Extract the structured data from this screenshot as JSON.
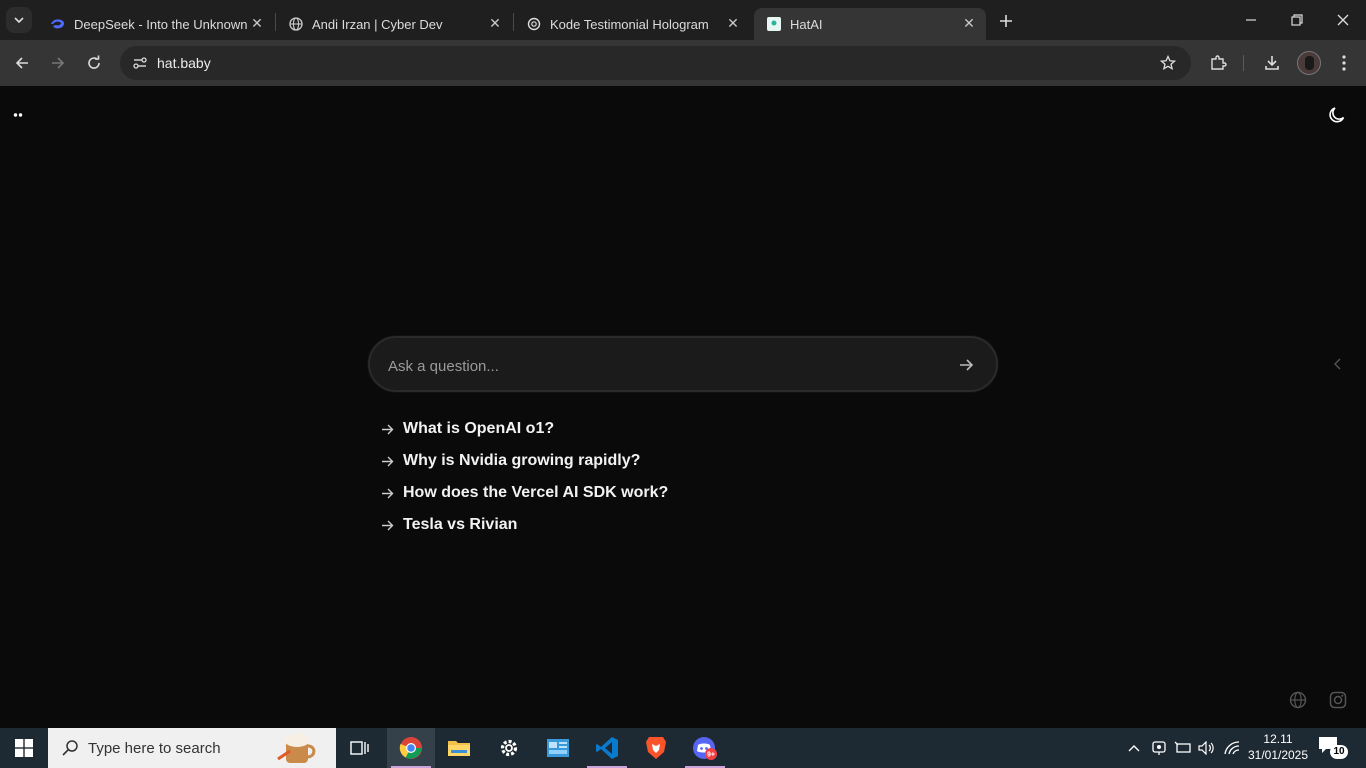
{
  "browser": {
    "tabs": [
      {
        "title": "DeepSeek - Into the Unknown",
        "icon": "deepseek-whale-icon",
        "active": false
      },
      {
        "title": "Andi Irzan | Cyber Dev",
        "icon": "globe-icon",
        "active": false
      },
      {
        "title": "Kode Testimonial Hologram",
        "icon": "chatgpt-icon",
        "active": false
      },
      {
        "title": "HatAI",
        "icon": "hatai-favicon",
        "active": true
      }
    ],
    "url": "hat.baby"
  },
  "page": {
    "search": {
      "placeholder": "Ask a question...",
      "value": ""
    },
    "suggestions": [
      "What is OpenAI o1?",
      "Why is Nvidia growing rapidly?",
      "How does the Vercel AI SDK work?",
      "Tesla vs Rivian"
    ]
  },
  "taskbar": {
    "search_placeholder": "Type here to search",
    "apps": [
      "task-view",
      "chrome",
      "file-explorer",
      "settings",
      "control-panel",
      "vscode",
      "brave",
      "discord"
    ],
    "discord_badge": "9+",
    "time": "12.11",
    "date": "31/01/2025",
    "notifications": "10"
  },
  "colors": {
    "page_bg": "#0a0a0a",
    "tabstrip_bg": "#1f1f1f",
    "toolbar_bg": "#353535",
    "taskbar_bg": "#1e2a33",
    "input_bg": "#1b1b1b"
  }
}
